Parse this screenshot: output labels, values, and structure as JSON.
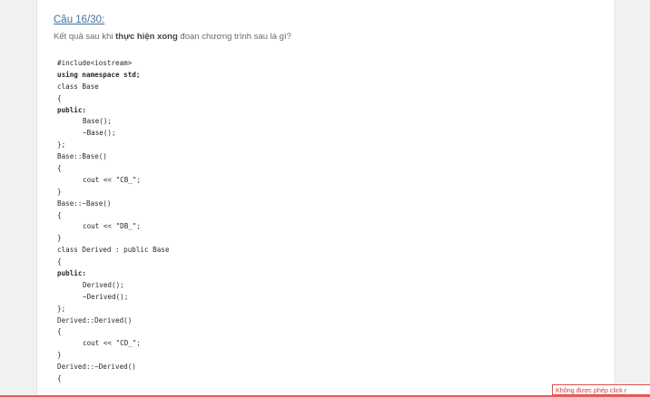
{
  "question": {
    "title": "Câu 16/30:",
    "prompt_before": "Kết quả sau khi ",
    "prompt_bold": "thực hiện xong",
    "prompt_after": " đoạn chương trình sau là gì?"
  },
  "code_lines": [
    {
      "text": "#include<iostream>",
      "indent": false,
      "bold": false
    },
    {
      "text": "using namespace std;",
      "indent": false,
      "bold": true
    },
    {
      "text": "class Base",
      "indent": false,
      "bold": false
    },
    {
      "text": "{",
      "indent": false,
      "bold": false
    },
    {
      "text": "public:",
      "indent": false,
      "bold": true
    },
    {
      "text": "Base();",
      "indent": true,
      "bold": false
    },
    {
      "text": "~Base();",
      "indent": true,
      "bold": false
    },
    {
      "text": "};",
      "indent": false,
      "bold": false
    },
    {
      "text": "Base::Base()",
      "indent": false,
      "bold": false
    },
    {
      "text": "{",
      "indent": false,
      "bold": false
    },
    {
      "text": "cout << \"CB_\";",
      "indent": true,
      "bold": false
    },
    {
      "text": "}",
      "indent": false,
      "bold": false
    },
    {
      "text": "Base::~Base()",
      "indent": false,
      "bold": false
    },
    {
      "text": "{",
      "indent": false,
      "bold": false
    },
    {
      "text": "cout << \"DB_\";",
      "indent": true,
      "bold": false
    },
    {
      "text": "}",
      "indent": false,
      "bold": false
    },
    {
      "text": "class Derived : public Base",
      "indent": false,
      "bold": false
    },
    {
      "text": "{",
      "indent": false,
      "bold": false
    },
    {
      "text": "public:",
      "indent": false,
      "bold": true
    },
    {
      "text": "Derived();",
      "indent": true,
      "bold": false
    },
    {
      "text": "~Derived();",
      "indent": true,
      "bold": false
    },
    {
      "text": "};",
      "indent": false,
      "bold": false
    },
    {
      "text": "Derived::Derived()",
      "indent": false,
      "bold": false
    },
    {
      "text": "{",
      "indent": false,
      "bold": false
    },
    {
      "text": "cout << \"CD_\";",
      "indent": true,
      "bold": false
    },
    {
      "text": "}",
      "indent": false,
      "bold": false
    },
    {
      "text": "Derived::~Derived()",
      "indent": false,
      "bold": false
    },
    {
      "text": "{",
      "indent": false,
      "bold": false
    }
  ],
  "warning": {
    "text": "Không được phép click r"
  },
  "colors": {
    "title": "#41719c",
    "warning": "#d33a3a"
  }
}
